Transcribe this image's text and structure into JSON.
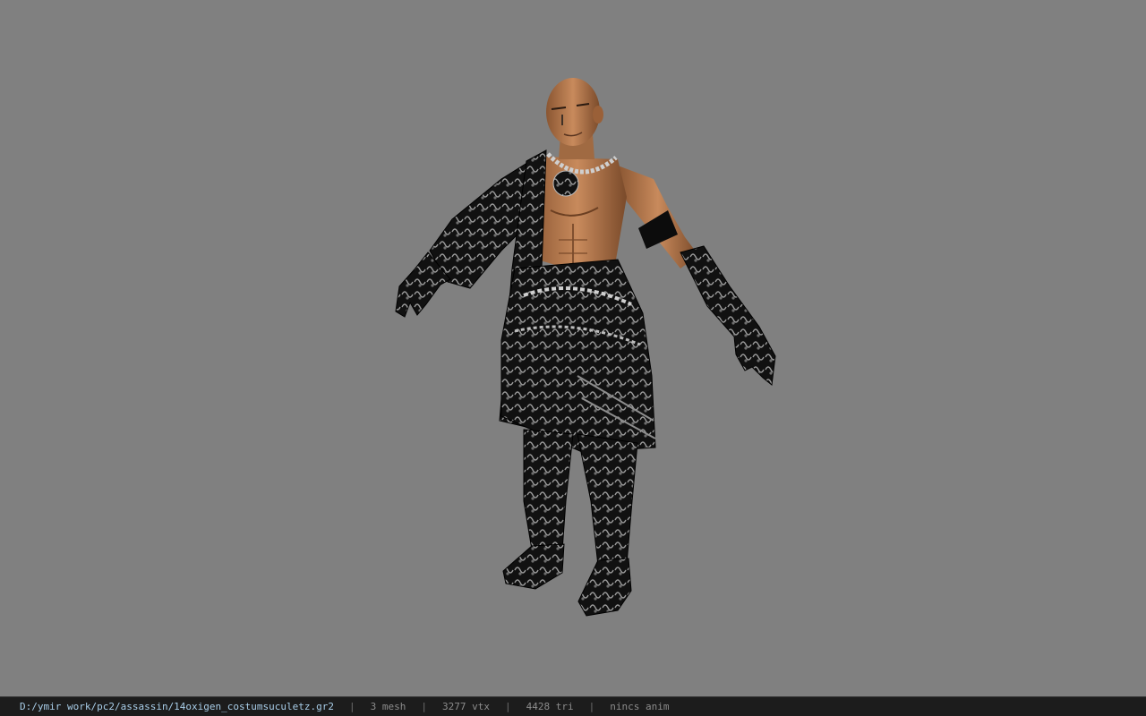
{
  "viewer": {
    "background_color": "#808080",
    "statusbar_color": "#1c1c1c",
    "path_color": "#a8cde8",
    "model": {
      "subject": "bald male assassin character wearing dark ornate armor costume, T-pose"
    }
  },
  "status": {
    "file_path": "D:/ymir work/pc2/assassin/14oxigen_costumsuculetz.gr2",
    "separator": "|",
    "mesh": "3 mesh",
    "vertices": "3277 vtx",
    "triangles": "4428 tri",
    "animation": "nincs anim"
  }
}
